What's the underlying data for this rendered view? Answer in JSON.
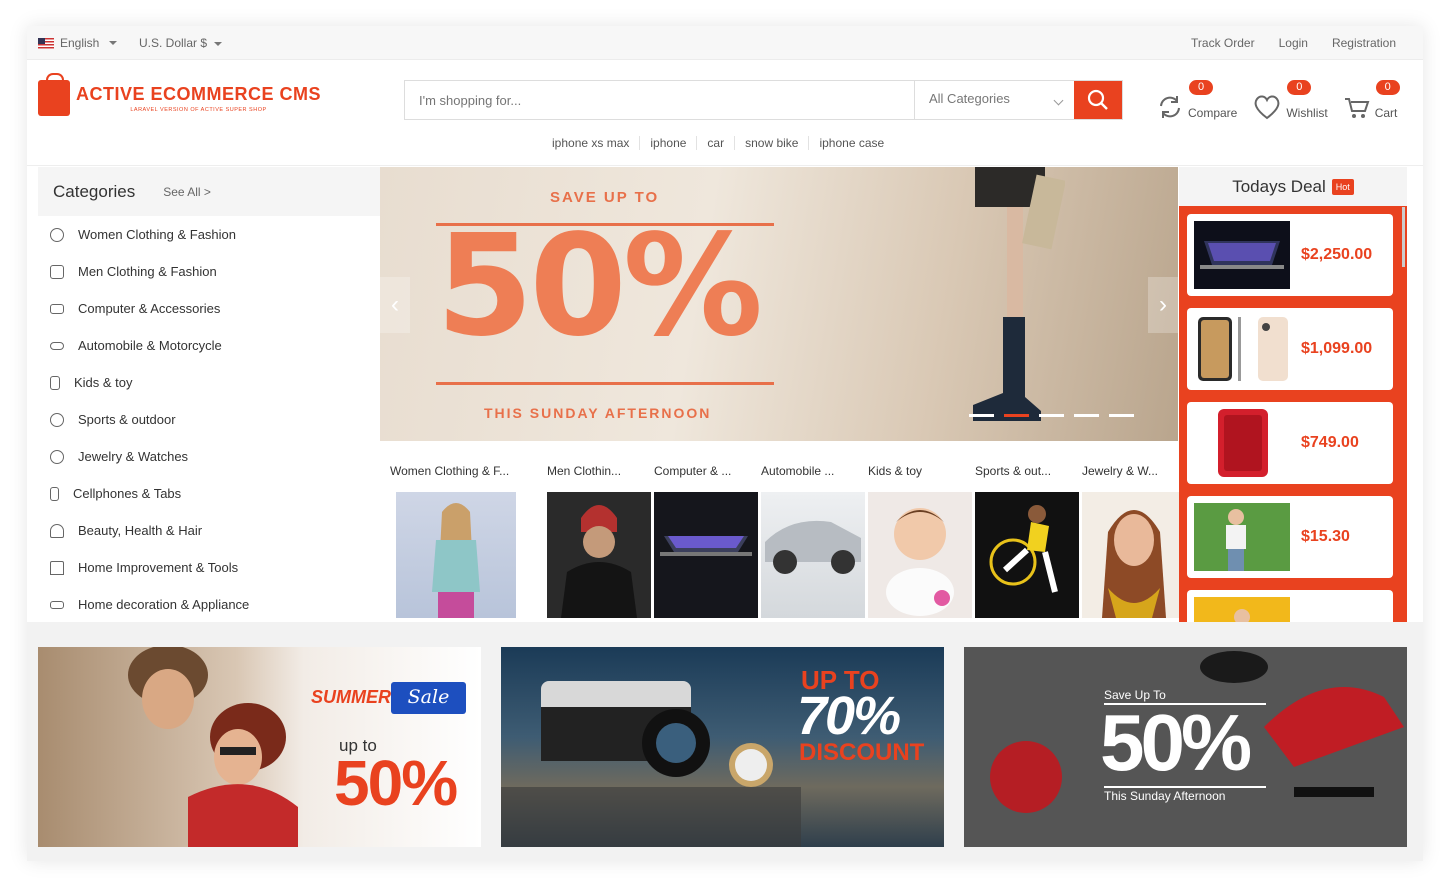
{
  "topbar": {
    "language": "English",
    "currency": "U.S. Dollar $",
    "links": [
      "Track Order",
      "Login",
      "Registration"
    ]
  },
  "logo": {
    "title": "ACTIVE ECOMMERCE CMS",
    "tagline": "LARAVEL VERSION OF ACTIVE SUPER SHOP"
  },
  "search": {
    "placeholder": "I'm shopping for...",
    "category": "All Categories",
    "hints": [
      "iphone xs max",
      "iphone",
      "car",
      "snow bike",
      "iphone case"
    ]
  },
  "header_icons": {
    "compare_label": "Compare",
    "compare_count": "0",
    "wishlist_label": "Wishlist",
    "wishlist_count": "0",
    "cart_label": "Cart",
    "cart_count": "0"
  },
  "sidebar": {
    "title": "Categories",
    "see_all": "See All >",
    "items": [
      "Women Clothing & Fashion",
      "Men Clothing & Fashion",
      "Computer & Accessories",
      "Automobile & Motorcycle",
      "Kids & toy",
      "Sports & outdoor",
      "Jewelry & Watches",
      "Cellphones & Tabs",
      "Beauty, Health & Hair",
      "Home Improvement & Tools",
      "Home decoration & Appliance"
    ]
  },
  "hero": {
    "save": "SAVE UP TO",
    "percent": "50%",
    "sub": "THIS SUNDAY AFTERNOON",
    "prev": "‹",
    "next": "›"
  },
  "tiles": [
    "Women Clothing & F...",
    "Men Clothin...",
    "Computer & ...",
    "Automobile ...",
    "Kids & toy",
    "Sports & out...",
    "Jewelry & W..."
  ],
  "deal": {
    "title": "Todays Deal",
    "badge": "Hot",
    "prices": [
      "$2,250.00",
      "$1,099.00",
      "$749.00",
      "$15.30"
    ]
  },
  "banners": {
    "b1": {
      "summer": "SUMMER",
      "sale": "Sale",
      "upto": "up to",
      "pct": "50%"
    },
    "b2": {
      "up": "UP TO",
      "pct": "70%",
      "disc": "DISCOUNT"
    },
    "b3": {
      "save": "Save Up To",
      "pct": "50%",
      "sub": "This Sunday Afternoon"
    }
  }
}
